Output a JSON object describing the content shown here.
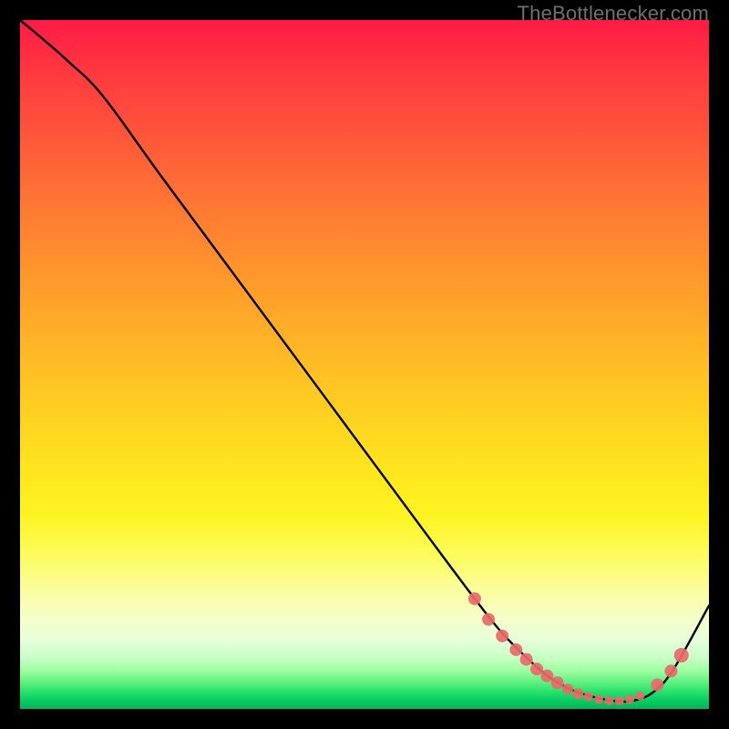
{
  "watermark": "TheBottlenecker.com",
  "chart_data": {
    "type": "line",
    "title": "",
    "xlabel": "",
    "ylabel": "",
    "xlim": [
      0,
      100
    ],
    "ylim": [
      0,
      100
    ],
    "background_gradient_stops": [
      {
        "pos": 0.0,
        "color": "#ff1a46"
      },
      {
        "pos": 0.5,
        "color": "#ffd321"
      },
      {
        "pos": 0.85,
        "color": "#fdfd95"
      },
      {
        "pos": 0.96,
        "color": "#5df07e"
      },
      {
        "pos": 1.0,
        "color": "#04b357"
      }
    ],
    "series": [
      {
        "name": "bottleneck-curve",
        "color": "#000000",
        "x": [
          0,
          3,
          7,
          12,
          20,
          30,
          40,
          50,
          60,
          66,
          70,
          74,
          77,
          80,
          83,
          86,
          89,
          92,
          95,
          100
        ],
        "y": [
          100,
          97.5,
          94,
          89,
          78,
          64.5,
          51,
          37.5,
          24,
          16,
          11,
          7,
          4.5,
          2.8,
          1.8,
          1.2,
          1.2,
          2.5,
          6,
          15
        ]
      }
    ],
    "markers": {
      "name": "highlight-points",
      "color": "#e86a6a",
      "size_small": 5,
      "size": 7,
      "size_large": 9,
      "points": [
        {
          "x": 66,
          "y": 16,
          "r": 7
        },
        {
          "x": 68,
          "y": 13,
          "r": 7
        },
        {
          "x": 70,
          "y": 10.6,
          "r": 7
        },
        {
          "x": 72,
          "y": 8.6,
          "r": 7
        },
        {
          "x": 73.5,
          "y": 7.2,
          "r": 7
        },
        {
          "x": 75,
          "y": 5.8,
          "r": 7
        },
        {
          "x": 76.5,
          "y": 4.8,
          "r": 7
        },
        {
          "x": 78,
          "y": 3.8,
          "r": 7
        },
        {
          "x": 79.5,
          "y": 2.9,
          "r": 6
        },
        {
          "x": 81,
          "y": 2.2,
          "r": 6
        },
        {
          "x": 82.5,
          "y": 1.8,
          "r": 5
        },
        {
          "x": 84,
          "y": 1.4,
          "r": 5
        },
        {
          "x": 85.5,
          "y": 1.2,
          "r": 5
        },
        {
          "x": 87,
          "y": 1.2,
          "r": 5
        },
        {
          "x": 88.5,
          "y": 1.4,
          "r": 5
        },
        {
          "x": 90,
          "y": 1.9,
          "r": 5
        },
        {
          "x": 92.5,
          "y": 3.5,
          "r": 7
        },
        {
          "x": 94.5,
          "y": 5.5,
          "r": 7
        },
        {
          "x": 96,
          "y": 7.8,
          "r": 8
        }
      ]
    }
  }
}
